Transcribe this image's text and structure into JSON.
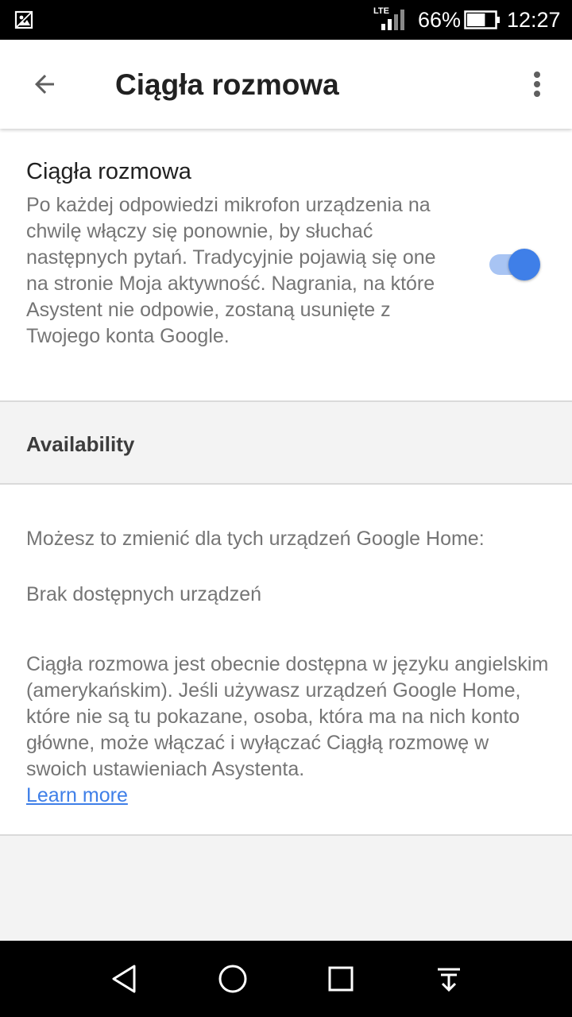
{
  "status_bar": {
    "network": "LTE",
    "battery_percent": "66%",
    "time": "12:27",
    "battery_level": 0.66,
    "icons": [
      "gallery-notification-icon",
      "signal-icon",
      "battery-icon"
    ]
  },
  "app_bar": {
    "title": "Ciągła rozmowa",
    "icons": [
      "back-arrow-icon",
      "more-vert-icon"
    ]
  },
  "setting": {
    "title": "Ciągła rozmowa",
    "description": "Po każdej odpowiedzi mikrofon urządzenia na chwilę włączy się ponownie, by słuchać następnych pytań. Tradycyjnie pojawią się one na stronie Moja aktywność. Nagrania, na które Asystent nie odpowie, zostaną usunięte z Twojego konta Google.",
    "toggle_on": true
  },
  "availability": {
    "header": "Availability",
    "line1": "Możesz to zmienić dla tych urządzeń Google Home:",
    "line2": "Brak dostępnych urządzeń",
    "line3": "Ciągła rozmowa jest obecnie dostępna w języku angielskim (amerykańskim). Jeśli używasz urządzeń Google Home, które nie są tu pokazane, osoba, która ma na nich konto główne, może włączać i wyłączać Ciągłą rozmowę w swoich ustawieniach Asystenta.",
    "learn_more": "Learn more"
  },
  "colors": {
    "accent": "#3f7fe8",
    "toggle_track": "#a8c4f3",
    "title_text": "#212121",
    "secondary_text": "#757575"
  },
  "nav_bar": {
    "icons": [
      "back-triangle-icon",
      "home-circle-icon",
      "recents-square-icon",
      "notification-pulldown-icon"
    ]
  }
}
